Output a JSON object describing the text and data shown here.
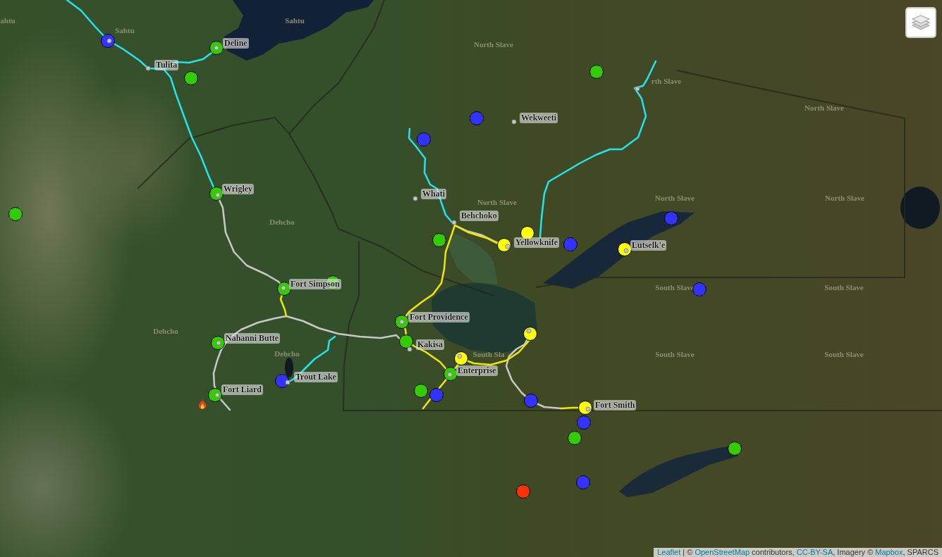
{
  "map": {
    "region_labels": [
      {
        "text": "ahtu"
      },
      {
        "text": "Sahtu"
      },
      {
        "text": "Sahtu"
      },
      {
        "text": "North Slave"
      },
      {
        "text": "rth Slave"
      },
      {
        "text": "North Slave"
      },
      {
        "text": "North Slave"
      },
      {
        "text": "North Slave"
      },
      {
        "text": "North Slave"
      },
      {
        "text": "Dehcho"
      },
      {
        "text": "Dehcho"
      },
      {
        "text": "Dehcho"
      },
      {
        "text": "South Sla"
      },
      {
        "text": "South Slave"
      },
      {
        "text": "South Slave"
      },
      {
        "text": "South Slave"
      },
      {
        "text": "South Slave"
      }
    ],
    "routes": [
      {
        "color": "#22e3ee"
      },
      {
        "color": "#22e3ee"
      },
      {
        "color": "#22e3ee"
      },
      {
        "color": "#22e3ee"
      },
      {
        "color": "#22e3ee"
      },
      {
        "color": "#c8c8c8"
      },
      {
        "color": "#c8c8c8"
      },
      {
        "color": "#c8c8c8"
      },
      {
        "color": "#c8c8c8"
      },
      {
        "color": "#f2e600"
      },
      {
        "color": "#f2e600"
      },
      {
        "color": "#f2e600"
      },
      {
        "color": "#f2e600"
      }
    ],
    "markers": [
      {
        "color": "#3333ff"
      },
      {
        "color": "#33cc00"
      },
      {
        "color": "#33cc00"
      },
      {
        "color": "#33cc00"
      },
      {
        "color": "#3333ff"
      },
      {
        "color": "#3333ff"
      },
      {
        "color": "#33cc00"
      },
      {
        "color": "#33cc00"
      },
      {
        "color": "#3333ff"
      },
      {
        "color": "#ffff00"
      },
      {
        "color": "#33cc00"
      },
      {
        "color": "#3333ff"
      },
      {
        "color": "#ffff00"
      },
      {
        "color": "#ffff00"
      },
      {
        "color": "#33cc00"
      },
      {
        "color": "#33cc00"
      },
      {
        "color": "#3333ff"
      },
      {
        "color": "#33cc00"
      },
      {
        "color": "#ffff00"
      },
      {
        "color": "#33cc00"
      },
      {
        "color": "#33cc00"
      },
      {
        "color": "#ffff00"
      },
      {
        "color": "#33cc00"
      },
      {
        "color": "#3333ff"
      },
      {
        "color": "#33cc00"
      },
      {
        "color": "#3333ff"
      },
      {
        "color": "#33cc00"
      },
      {
        "color": "#3333ff"
      },
      {
        "color": "#ffff00"
      },
      {
        "color": "#3333ff"
      },
      {
        "color": "#33cc00"
      },
      {
        "color": "#33cc00"
      },
      {
        "color": "#3333ff"
      },
      {
        "color": "#ff3300"
      }
    ],
    "places": [
      {
        "name": "Deline"
      },
      {
        "name": "Tulita"
      },
      {
        "name": "Wrigley"
      },
      {
        "name": "Wekweeti"
      },
      {
        "name": "Whati"
      },
      {
        "name": "Behchoko"
      },
      {
        "name": "Yellowknife"
      },
      {
        "name": "Lutselk'e"
      },
      {
        "name": "Fort Simpson"
      },
      {
        "name": "Fort Providence"
      },
      {
        "name": "Kakisa"
      },
      {
        "name": "Nahanni Butte"
      },
      {
        "name": "Trout Lake"
      },
      {
        "name": "Enterprise"
      },
      {
        "name": "Fort Liard"
      },
      {
        "name": "Fort Smith"
      }
    ]
  },
  "attribution": [
    {
      "kind": "link",
      "text": "Leaflet"
    },
    {
      "kind": "text",
      "text": " | © "
    },
    {
      "kind": "link",
      "text": "OpenStreetMap"
    },
    {
      "kind": "text",
      "text": " contributors, "
    },
    {
      "kind": "link",
      "text": "CC-BY-SA"
    },
    {
      "kind": "text",
      "text": ", Imagery © "
    },
    {
      "kind": "link",
      "text": "Mapbox"
    },
    {
      "kind": "text",
      "text": ", SPARCS"
    }
  ]
}
